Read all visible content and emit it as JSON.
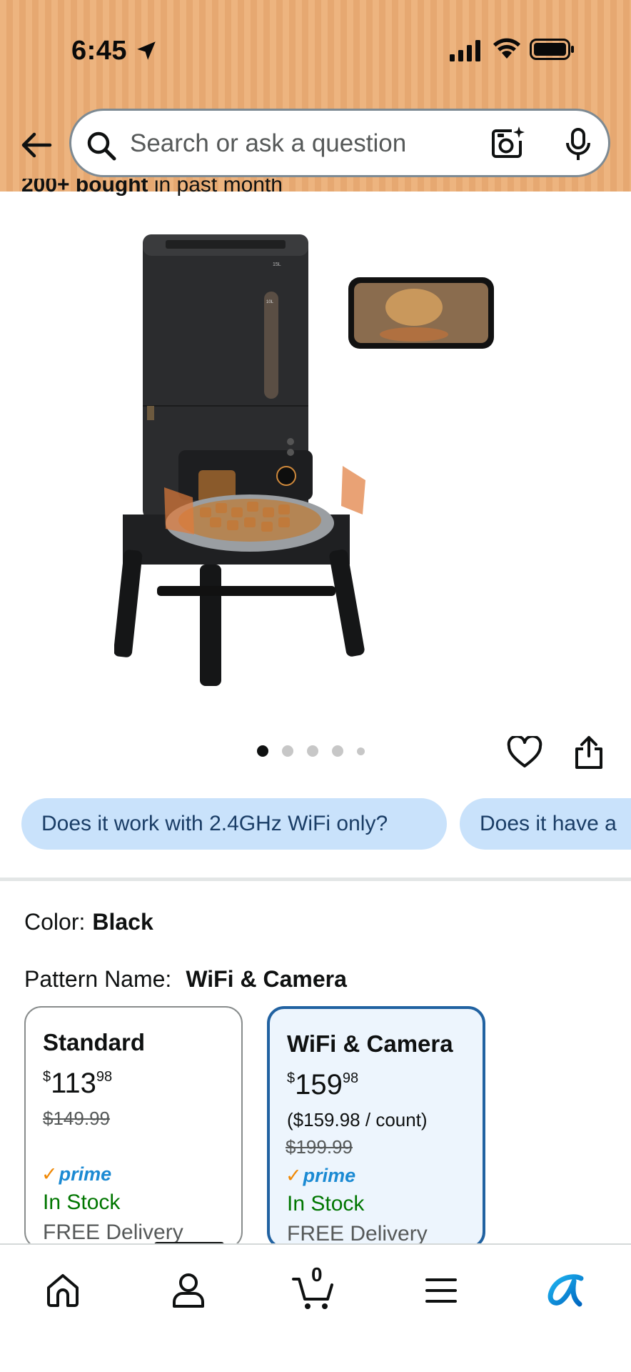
{
  "status_bar": {
    "time": "6:45",
    "location_icon": "location-arrow-icon",
    "signal_icon": "cellular-signal-icon",
    "wifi_icon": "wifi-icon",
    "battery_icon": "battery-icon"
  },
  "search": {
    "placeholder": "Search or ask a question",
    "value": "",
    "icons": [
      "back-arrow-icon",
      "search-icon",
      "camera-lens-icon",
      "microphone-icon"
    ]
  },
  "product": {
    "bought_prefix": "200+ bought",
    "bought_suffix": " in past month",
    "image_count": 5,
    "active_image": 1
  },
  "questions": [
    "Does it work with 2.4GHz WiFi only?",
    "Does it have a"
  ],
  "options": {
    "color_label": "Color:",
    "color_value": "Black",
    "pattern_label": "Pattern Name:",
    "pattern_value": "WiFi & Camera"
  },
  "variants": [
    {
      "name": "Standard",
      "price_symbol": "$",
      "price_whole": "113",
      "price_fraction": "98",
      "unit_price": "",
      "list_price": "$149.99",
      "prime": "prime",
      "stock": "In Stock",
      "delivery": "FREE Delivery",
      "selected": false
    },
    {
      "name": "WiFi & Camera",
      "price_symbol": "$",
      "price_whole": "159",
      "price_fraction": "98",
      "unit_price": "($159.98 / count)",
      "list_price": "$199.99",
      "prime": "prime",
      "stock": "In Stock",
      "delivery": "FREE Delivery",
      "selected": true
    }
  ],
  "bottom_nav": {
    "cart_count": "0",
    "items": [
      "home-icon",
      "account-icon",
      "cart-icon",
      "menu-icon",
      "rufus-icon"
    ]
  },
  "colors": {
    "header_bg": "#edb47f",
    "chip_bg": "#c9e2fb",
    "chip_text": "#1a3d66",
    "selected_border": "#2162a1",
    "selected_bg": "#edf5fd",
    "in_stock": "#007600",
    "prime_blue": "#1b8ad3",
    "prime_check": "#f08804",
    "rufus_gradient_start": "#1fb6f1",
    "rufus_gradient_end": "#0066c0"
  }
}
